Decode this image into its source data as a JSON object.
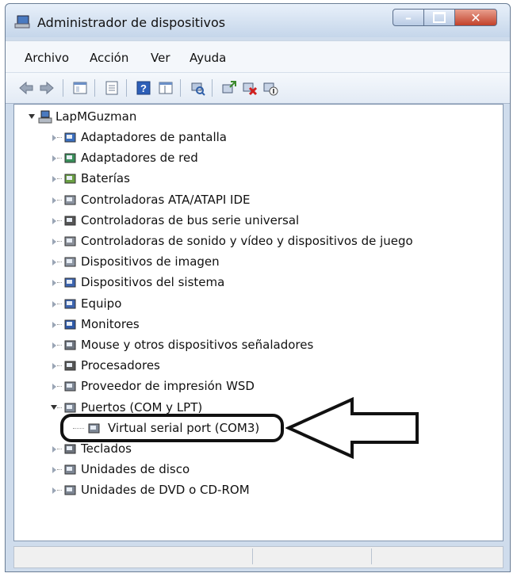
{
  "window": {
    "title": "Administrador de dispositivos",
    "buttons": {
      "minimize": "–",
      "maximize": "□",
      "close": "x"
    }
  },
  "menu": [
    "Archivo",
    "Acción",
    "Ver",
    "Ayuda"
  ],
  "toolbar": {
    "icons": [
      "back-icon",
      "forward-icon",
      "show-hide-tree-icon",
      "properties-icon",
      "help-icon",
      "view-icon",
      "scan-hardware-icon",
      "update-driver-icon",
      "uninstall-icon",
      "disable-icon"
    ]
  },
  "tree": {
    "root": "LapMGuzman",
    "items": [
      {
        "label": "Adaptadores de pantalla",
        "icon": "display-adapter-icon"
      },
      {
        "label": "Adaptadores de red",
        "icon": "network-adapter-icon"
      },
      {
        "label": "Baterías",
        "icon": "battery-icon"
      },
      {
        "label": "Controladoras ATA/ATAPI IDE",
        "icon": "ide-controller-icon"
      },
      {
        "label": "Controladoras de bus serie universal",
        "icon": "usb-controller-icon"
      },
      {
        "label": "Controladoras de sonido y vídeo y dispositivos de juego",
        "icon": "sound-icon"
      },
      {
        "label": "Dispositivos de imagen",
        "icon": "scanner-icon"
      },
      {
        "label": "Dispositivos del sistema",
        "icon": "system-device-icon"
      },
      {
        "label": "Equipo",
        "icon": "computer-icon"
      },
      {
        "label": "Monitores",
        "icon": "monitor-icon"
      },
      {
        "label": "Mouse y otros dispositivos señaladores",
        "icon": "mouse-icon"
      },
      {
        "label": "Procesadores",
        "icon": "processor-icon"
      },
      {
        "label": "Proveedor de impresión WSD",
        "icon": "printer-icon"
      },
      {
        "label": "Puertos (COM y LPT)",
        "icon": "port-icon",
        "expanded": true,
        "children": [
          {
            "label": "Virtual serial port (COM3)",
            "icon": "serial-port-icon"
          }
        ]
      },
      {
        "label": "Teclados",
        "icon": "keyboard-icon"
      },
      {
        "label": "Unidades de disco",
        "icon": "disk-drive-icon"
      },
      {
        "label": "Unidades de DVD o CD-ROM",
        "icon": "dvd-drive-icon"
      }
    ]
  }
}
